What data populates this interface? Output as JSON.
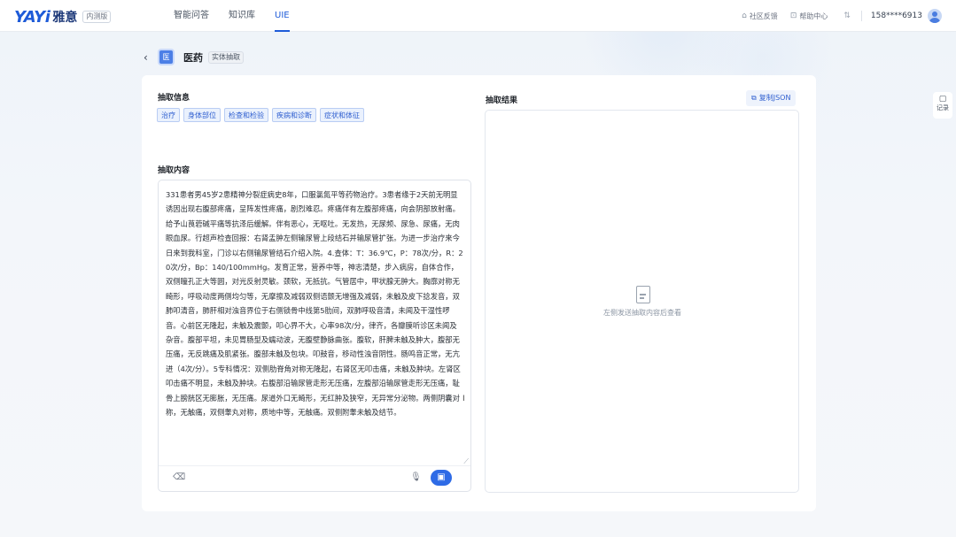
{
  "header": {
    "logo_text": "YAYi",
    "logo_cn": "雅意",
    "logo_badge": "内测版",
    "nav": [
      {
        "label": "智能问答",
        "active": false
      },
      {
        "label": "知识库",
        "active": false
      },
      {
        "label": "UIE",
        "active": true
      }
    ],
    "feedback_label": "社区反馈",
    "help_label": "帮助中心",
    "phone": "158****6913"
  },
  "page": {
    "back_icon": "‹",
    "title_icon_text": "医",
    "title": "医药",
    "tag": "实体抽取"
  },
  "extract_info": {
    "label": "抽取信息",
    "tags": [
      "治疗",
      "身体部位",
      "检查和检验",
      "疾病和诊断",
      "症状和体征"
    ]
  },
  "extract_content": {
    "label": "抽取内容",
    "text": "331患者男45岁2患精神分裂症病史8年，口服氯氮平等药物治疗。3患者缘于2天前无明显诱因出现右腹部疼痛，呈阵发性疼痛，剧烈难忍。疼痛伴有左腹部疼痛，向会阴部放射痛。给予山莨菪碱平痛等抗泽后缓解。伴有恶心，无呕吐。无发热，无尿频、尿急、尿痛，无肉眼血尿。行超声检查回报：右肾盂肿左侧输尿管上段结石并输尿管扩张。为进一步治疗来今日来到我科室，门诊以右侧输尿管结石介绍入院。4.查体：T：36.9℃，P：78次/分，R：20次/分，Bp：140/100mmHg。发育正常，营养中等，神志清楚，步入病房，自体合作，双侧瞳孔正大等圆，对光反射灵敏。颈软，无抵抗。气管居中，甲状腺无肿大。胸廓对称无畸形，呼吸动度两侧均匀等，无摩擦及减弱双侧语颤无增强及减弱，未触及皮下捻发音，双肺叩清音，肺肝相对浊音界位于右侧锁骨中线第5肋间，双肺呼吸音清，未闻及干湿性啰音。心前区无隆起，未触及震颤，叩心界不大，心率98次/分，律齐，各瓣膜听诊区未闻及杂音。腹部平坦，未见胃肠型及蠕动波，无腹壁静脉曲张。腹软，肝脾未触及肿大，腹部无压痛，无反跳痛及肌紧张。腹部未触及包块。叩鼓音，移动性浊音阴性。肠鸣音正常，无亢进（4次/分）。5专科情况：双侧肋脊角对称无隆起，右肾区无叩击痛，未触及肿块。左肾区叩击痛不明显，未触及肿块。右腹部沿输尿管走形无压痛，左腹部沿输尿管走形无压痛，耻骨上膀胱区无膨胀，无压痛。尿道外口无畸形，无红肿及狭窄，无异常分泌物。两侧阴囊对称，无触痛，双侧睾丸对称，质地中等，无触痛。双侧附睾未触及结节。"
  },
  "result": {
    "label": "抽取结果",
    "copy_label": "复制JSON",
    "empty_text": "左侧发送抽取内容后查看"
  },
  "float_panel": {
    "label": "记录"
  },
  "icons": {
    "feedback": "⌂",
    "help": "⊡",
    "translate": "⇅",
    "copy": "⧉",
    "clear": "⌫",
    "mic": "🎙",
    "send": "▣",
    "record": "▢",
    "text_cursor": "I",
    "resize": "⟋"
  },
  "colors": {
    "accent": "#2e6be6",
    "tag_bg": "#eaf1fd",
    "tag_text": "#2f5fd0"
  }
}
